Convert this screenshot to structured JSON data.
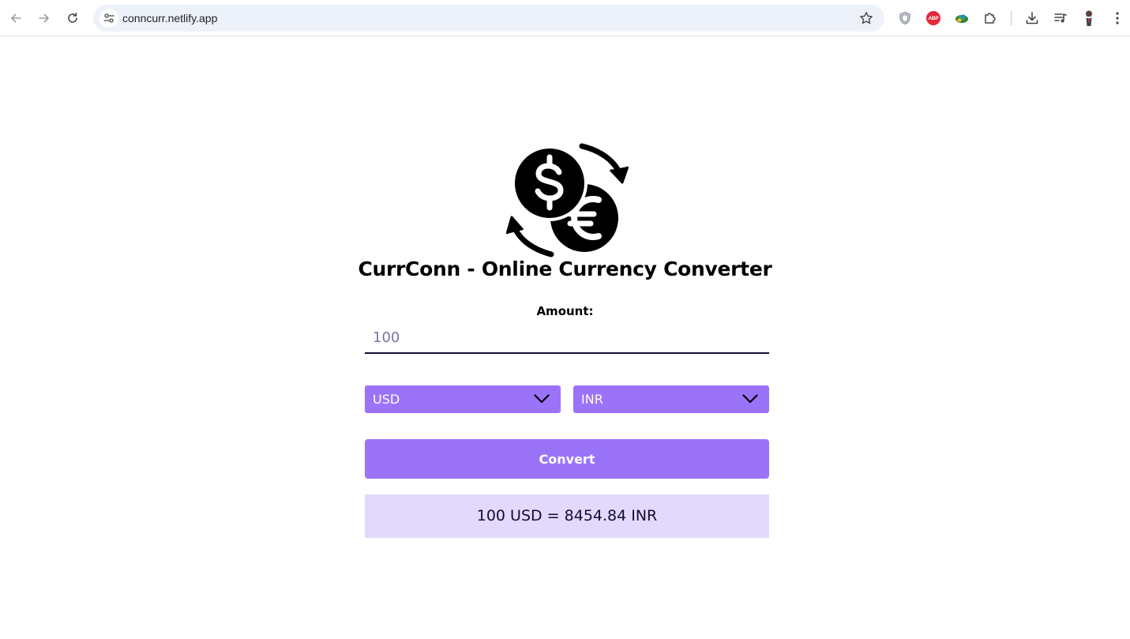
{
  "browser": {
    "url": "conncurr.netlify.app",
    "icons": {
      "back": "back-arrow-icon",
      "forward": "forward-arrow-icon",
      "reload": "reload-icon",
      "site_info": "tune-icon",
      "bookmark": "star-icon",
      "extensions": [
        "shield-extension-icon",
        "adblock-plus-icon",
        "globe-extension-icon",
        "puzzle-extensions-icon"
      ],
      "downloads": "download-icon",
      "media": "media-queue-icon",
      "menu": "kebab-menu-icon"
    },
    "adblock_badge": "ABP"
  },
  "app": {
    "logo_icon": "currency-exchange-icon",
    "title": "CurrConn - Online Currency Converter",
    "amount_label": "Amount:",
    "amount_value": "100",
    "from_currency": "USD",
    "to_currency": "INR",
    "convert_label": "Convert",
    "result_text": "100 USD = 8454.84 INR"
  },
  "colors": {
    "accent": "#9b73f9",
    "result_background": "#e3d9fd",
    "omnibox_background": "#edf2fa",
    "input_underline": "#160f3a"
  }
}
